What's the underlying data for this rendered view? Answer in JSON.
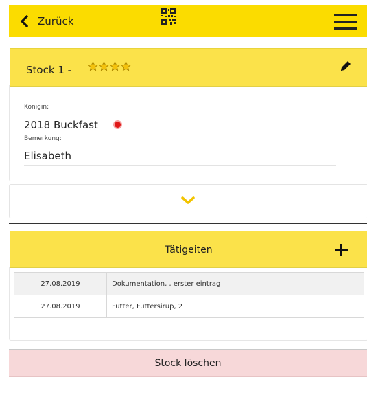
{
  "topbar": {
    "back_label": "Zurück",
    "back_icon": "chevron-left-icon",
    "qr_icon": "qr-code-icon",
    "menu_icon": "hamburger-menu-icon",
    "background_color": "#fbdc00"
  },
  "hive": {
    "title": "Stock 1 -",
    "rating": 4,
    "rating_max": 4,
    "edit_icon": "pencil-icon"
  },
  "queen": {
    "label": "Königin:",
    "value": "2018 Buckfast",
    "status_color": "#e01818"
  },
  "note": {
    "label": "Bemerkung:",
    "value": "Elisabeth"
  },
  "expand": {
    "icon": "chevron-down-icon"
  },
  "activities": {
    "title": "Tätigeiten",
    "add_icon": "plus-icon",
    "rows": [
      {
        "date": "27.08.2019",
        "description": "Dokumentation, , erster eintrag"
      },
      {
        "date": "27.08.2019",
        "description": "Futter, Futtersirup, 2"
      }
    ]
  },
  "delete": {
    "label": "Stock löschen",
    "background_color": "#f7d8d9"
  }
}
